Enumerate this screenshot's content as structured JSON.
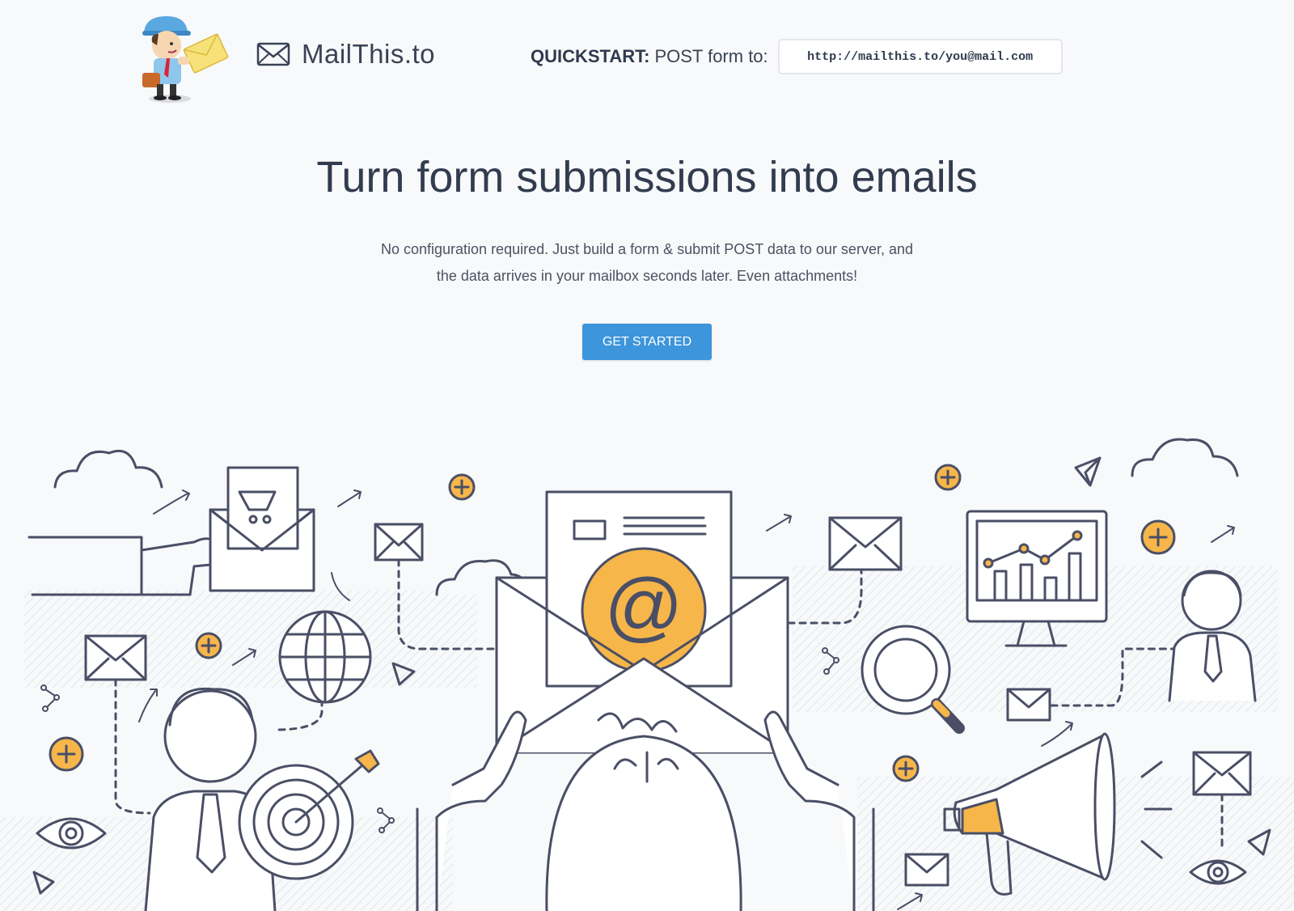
{
  "header": {
    "brand": "MailThis.to",
    "quickstart_label": "QUICKSTART:",
    "quickstart_text": "POST form to:",
    "quickstart_url": "http://mailthis.to/you@mail.com"
  },
  "hero": {
    "title": "Turn form submissions into emails",
    "subtitle_line1": "No configuration required. Just build a form & submit POST data to our server, and",
    "subtitle_line2": "the data arrives in your mailbox seconds later. Even attachments!",
    "cta_label": "GET STARTED"
  },
  "illustration": {
    "at_symbol": "@"
  },
  "colors": {
    "background": "#f8f9fa",
    "text": "#3a4255",
    "accent": "#3d95db",
    "orange": "#f7b64a",
    "line": "#4a4f66"
  },
  "icons": [
    "mailman-mascot",
    "envelope-icon",
    "cloud-icon",
    "plus-icon",
    "globe-icon",
    "magnifier-icon",
    "monitor-chart-icon",
    "megaphone-icon",
    "eye-icon",
    "target-icon",
    "paper-plane-icon",
    "person-icon"
  ]
}
